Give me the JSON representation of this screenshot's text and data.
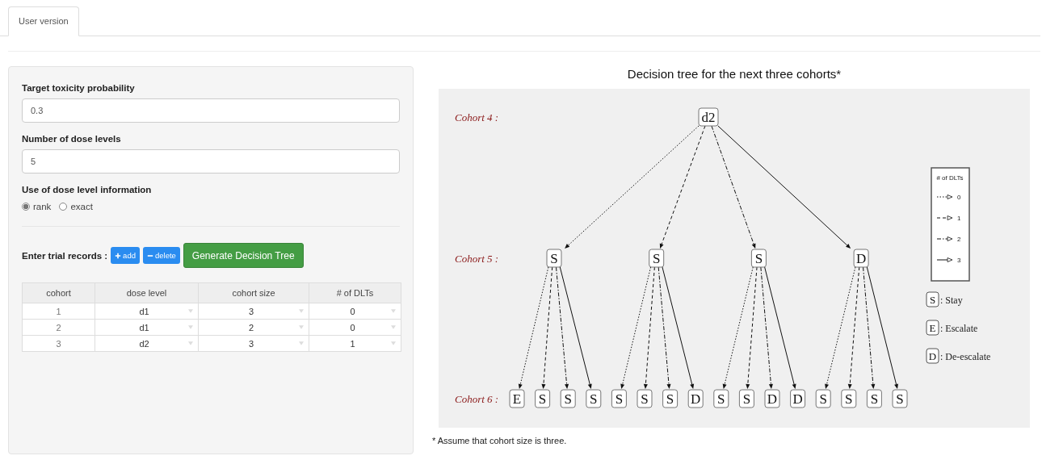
{
  "tabs": [
    {
      "label": "User version",
      "selected": true
    }
  ],
  "form": {
    "target": {
      "label": "Target toxicity probability",
      "value": "0.3"
    },
    "levels": {
      "label": "Number of dose levels",
      "value": "5"
    },
    "info": {
      "label": "Use of dose level information",
      "options": [
        {
          "label": "rank",
          "selected": true
        },
        {
          "label": "exact",
          "selected": false
        }
      ]
    },
    "records_label": "Enter trial records :",
    "add_button": "add",
    "delete_button": "delete",
    "generate_button": "Generate Decision Tree"
  },
  "table": {
    "columns": [
      "cohort",
      "dose level",
      "cohort size",
      "# of DLTs"
    ],
    "rows": [
      [
        "1",
        "d1",
        "3",
        "0"
      ],
      [
        "2",
        "d1",
        "2",
        "0"
      ],
      [
        "3",
        "d2",
        "3",
        "1"
      ]
    ]
  },
  "tree": {
    "title": "Decision tree for the next three cohorts*",
    "level_labels": [
      "Cohort 4 :",
      "Cohort 5 :",
      "Cohort 6 :"
    ],
    "root": {
      "label": "d2",
      "children": [
        {
          "label": "S",
          "children": [
            {
              "label": "E"
            },
            {
              "label": "S"
            },
            {
              "label": "S"
            },
            {
              "label": "S"
            }
          ]
        },
        {
          "label": "S",
          "children": [
            {
              "label": "S"
            },
            {
              "label": "S"
            },
            {
              "label": "S"
            },
            {
              "label": "D"
            }
          ]
        },
        {
          "label": "S",
          "children": [
            {
              "label": "S"
            },
            {
              "label": "S"
            },
            {
              "label": "D"
            },
            {
              "label": "D"
            }
          ]
        },
        {
          "label": "D",
          "children": [
            {
              "label": "S"
            },
            {
              "label": "S"
            },
            {
              "label": "S"
            },
            {
              "label": "S"
            }
          ]
        }
      ]
    },
    "legend": {
      "title": "# of DLTs",
      "items": [
        "0",
        "1",
        "2",
        "3"
      ]
    },
    "key": [
      {
        "letter": "S",
        "text": ": Stay"
      },
      {
        "letter": "E",
        "text": ": Escalate"
      },
      {
        "letter": "D",
        "text": ": De-escalate"
      }
    ],
    "footnote": "* Assume that cohort size is three."
  }
}
